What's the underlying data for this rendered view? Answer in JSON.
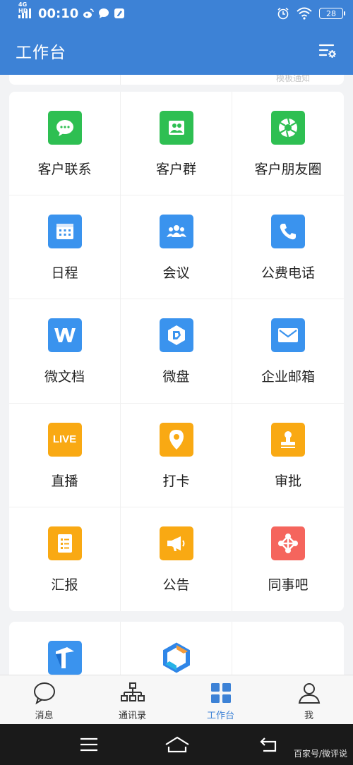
{
  "status_bar": {
    "network": "4G HD",
    "time": "00:10",
    "battery": "28"
  },
  "header": {
    "title": "工作台",
    "settings_icon": "settings-list-icon"
  },
  "previous_card": {
    "cut_text": "模板通知"
  },
  "apps": [
    {
      "label": "客户联系",
      "icon": "chat-bubble-icon",
      "color": "#2ebf52"
    },
    {
      "label": "客户群",
      "icon": "group-icon",
      "color": "#2ebf52"
    },
    {
      "label": "客户朋友圈",
      "icon": "moments-aperture-icon",
      "color": "#2ebf52"
    },
    {
      "label": "日程",
      "icon": "calendar-icon",
      "color": "#3a93ee"
    },
    {
      "label": "会议",
      "icon": "meeting-icon",
      "color": "#3a93ee"
    },
    {
      "label": "公费电话",
      "icon": "phone-icon",
      "color": "#3a93ee"
    },
    {
      "label": "微文档",
      "icon": "document-w-icon",
      "color": "#3a93ee"
    },
    {
      "label": "微盘",
      "icon": "cloud-disk-icon",
      "color": "#3a93ee"
    },
    {
      "label": "企业邮箱",
      "icon": "mail-icon",
      "color": "#3a93ee"
    },
    {
      "label": "直播",
      "icon": "live-icon",
      "live_text": "LIVE",
      "color": "#f9a913"
    },
    {
      "label": "打卡",
      "icon": "location-pin-icon",
      "color": "#f9a913"
    },
    {
      "label": "审批",
      "icon": "stamp-icon",
      "color": "#f9a913"
    },
    {
      "label": "汇报",
      "icon": "report-icon",
      "color": "#f9a913"
    },
    {
      "label": "公告",
      "icon": "megaphone-icon",
      "color": "#f9a913"
    },
    {
      "label": "同事吧",
      "icon": "colleague-network-icon",
      "color": "#f5655d"
    }
  ],
  "extra_apps": [
    {
      "icon": "task-t-icon",
      "color": "#3a93ee"
    },
    {
      "icon": "hexagon-app-icon",
      "color": "#3a93ee"
    }
  ],
  "tabbar": {
    "tabs": [
      {
        "label": "消息",
        "icon": "message-bubble-icon",
        "active": false
      },
      {
        "label": "通讯录",
        "icon": "org-chart-icon",
        "active": false
      },
      {
        "label": "工作台",
        "icon": "grid-icon",
        "active": true
      },
      {
        "label": "我",
        "icon": "person-icon",
        "active": false
      }
    ]
  },
  "nav": {
    "watermark": "百家号/微评说"
  },
  "colors": {
    "brand_blue": "#3d82d6",
    "green": "#2ebf52",
    "blue": "#3a93ee",
    "orange": "#f9a913",
    "red": "#f5655d"
  }
}
